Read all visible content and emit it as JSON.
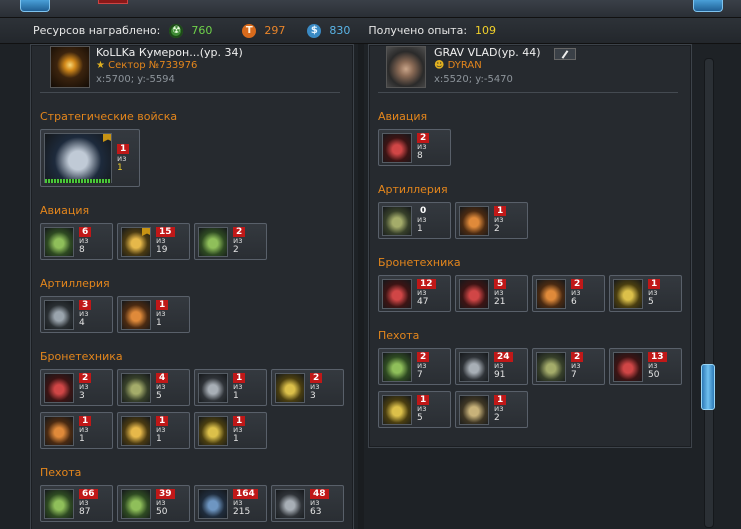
{
  "resources": {
    "label": "Ресурсов награблено:",
    "values": [
      {
        "icon": "radiation-icon",
        "glyph": "☢",
        "value": "760",
        "color": "#6fd24a"
      },
      {
        "icon": "titanium-icon",
        "glyph": "T",
        "value": "297",
        "color": "#e8842a"
      },
      {
        "icon": "money-icon",
        "glyph": "$",
        "value": "830",
        "color": "#5ab4e6"
      }
    ],
    "exp_label": "Получено опыта:",
    "exp_value": "109"
  },
  "left": {
    "player_name": "KoLLKa Кумерон...(ур. 34)",
    "sector": "Сектор №733976",
    "coords": "x:5700; y:-5594",
    "sections": [
      {
        "title": "Стратегические войска",
        "units": [
          {
            "img": "mothership-icon",
            "killed": "1",
            "of": "из",
            "total": "1",
            "big": true,
            "rank": true
          }
        ]
      },
      {
        "title": "Авиация",
        "units": [
          {
            "img": "green-mech-icon",
            "killed": "6",
            "of": "из",
            "total": "8"
          },
          {
            "img": "gold-drone-icon",
            "killed": "15",
            "of": "из",
            "total": "19",
            "rank": true
          },
          {
            "img": "green-walker-icon",
            "killed": "2",
            "of": "из",
            "total": "2"
          }
        ]
      },
      {
        "title": "Артиллерия",
        "units": [
          {
            "img": "artillery-tank-icon",
            "killed": "3",
            "of": "из",
            "total": "4"
          },
          {
            "img": "orange-spider-icon",
            "killed": "1",
            "of": "из",
            "total": "1"
          }
        ]
      },
      {
        "title": "Бронетехника",
        "units": [
          {
            "img": "red-tank-icon",
            "killed": "2",
            "of": "из",
            "total": "3"
          },
          {
            "img": "camo-tank-icon",
            "killed": "4",
            "of": "из",
            "total": "5"
          },
          {
            "img": "gray-walker-icon",
            "killed": "1",
            "of": "из",
            "total": "1"
          },
          {
            "img": "yellow-tank-icon",
            "killed": "2",
            "of": "из",
            "total": "3"
          },
          {
            "img": "orange-crab-icon",
            "killed": "1",
            "of": "из",
            "total": "1"
          },
          {
            "img": "gold-tank-icon",
            "killed": "1",
            "of": "из",
            "total": "1"
          },
          {
            "img": "yellow-walker-icon",
            "killed": "1",
            "of": "из",
            "total": "1"
          }
        ]
      },
      {
        "title": "Пехота",
        "units": [
          {
            "img": "green-soldier-icon",
            "killed": "66",
            "of": "из",
            "total": "87"
          },
          {
            "img": "green-robot-icon",
            "killed": "39",
            "of": "из",
            "total": "50"
          },
          {
            "img": "blue-soldier-icon",
            "killed": "164",
            "of": "из",
            "total": "215"
          },
          {
            "img": "gray-soldier-icon",
            "killed": "48",
            "of": "из",
            "total": "63"
          }
        ]
      }
    ]
  },
  "right": {
    "player_name": "GRAV VLAD(ур. 44)",
    "sector": "DYRAN",
    "coords": "x:5520; y:-5470",
    "sections": [
      {
        "title": "Авиация",
        "units": [
          {
            "img": "red-drone-icon",
            "killed": "2",
            "of": "из",
            "total": "8"
          }
        ]
      },
      {
        "title": "Артиллерия",
        "units": [
          {
            "img": "camo-artillery-icon",
            "killed": "0",
            "of": "из",
            "total": "1",
            "plain": true
          },
          {
            "img": "orange-spider-icon",
            "killed": "1",
            "of": "из",
            "total": "2"
          }
        ]
      },
      {
        "title": "Бронетехника",
        "units": [
          {
            "img": "red-tank-icon",
            "killed": "12",
            "of": "из",
            "total": "47"
          },
          {
            "img": "red-crab-icon",
            "killed": "5",
            "of": "из",
            "total": "21"
          },
          {
            "img": "orange-crab-icon",
            "killed": "2",
            "of": "из",
            "total": "6"
          },
          {
            "img": "yellow-walker-icon",
            "killed": "1",
            "of": "из",
            "total": "5"
          }
        ]
      },
      {
        "title": "Пехота",
        "units": [
          {
            "img": "green-soldier-icon",
            "killed": "2",
            "of": "из",
            "total": "7"
          },
          {
            "img": "gray-soldier-icon",
            "killed": "24",
            "of": "из",
            "total": "91"
          },
          {
            "img": "camo-soldier-icon",
            "killed": "2",
            "of": "из",
            "total": "7"
          },
          {
            "img": "red-robot-icon",
            "killed": "13",
            "of": "из",
            "total": "50"
          },
          {
            "img": "yellow-soldier-icon",
            "killed": "1",
            "of": "из",
            "total": "5"
          },
          {
            "img": "tan-soldier-icon",
            "killed": "1",
            "of": "из",
            "total": "2"
          }
        ]
      }
    ]
  }
}
